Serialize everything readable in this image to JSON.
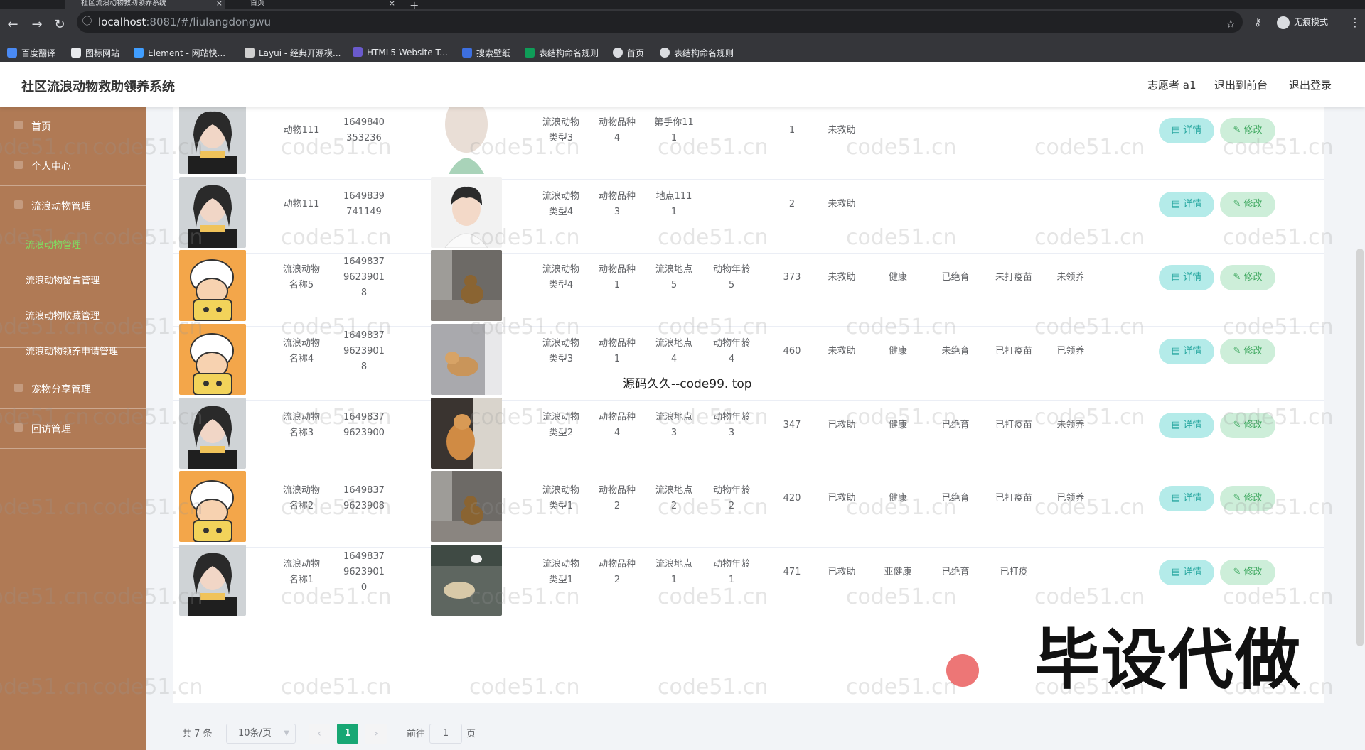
{
  "browser": {
    "tabs": [
      {
        "title": "社区流浪动物救助领养系统"
      },
      {
        "title": "首页"
      }
    ],
    "url_host": "localhost",
    "url_path": ":8081/#/liulangdongwu",
    "incognito_label": "无痕模式",
    "bookmarks": [
      "百度翻译",
      "图标网站",
      "Element - 网站快...",
      "Layui - 经典开源模...",
      "HTML5 Website T...",
      "搜索壁纸",
      "表结构命名规则",
      "首页",
      "表结构命名规则"
    ]
  },
  "header": {
    "title": "社区流浪动物救助领养系统",
    "user": "志愿者 a1",
    "to_front": "退出到前台",
    "logout": "退出登录"
  },
  "sidebar": {
    "items": [
      {
        "label": "首页"
      },
      {
        "label": "个人中心"
      },
      {
        "label": "流浪动物管理"
      },
      {
        "label": "宠物分享管理"
      },
      {
        "label": "回访管理"
      }
    ],
    "subitems": [
      "流浪动物管理",
      "流浪动物留言管理",
      "流浪动物收藏管理",
      "流浪动物领养申请管理"
    ]
  },
  "table": {
    "detail_label": "详情",
    "edit_label": "修改",
    "rows": [
      {
        "avatar": "girl",
        "name": "动物111",
        "id": "1649840\n353236",
        "photo": "partial",
        "type": "流浪动物\n类型3",
        "breed": "动物品种\n4",
        "location": "第手你11\n1",
        "age": "",
        "count": "1",
        "rescue": "未救助",
        "health": "",
        "neuter": "",
        "vaccine": "",
        "adopt": ""
      },
      {
        "avatar": "girl",
        "name": "动物111",
        "id": "1649839\n741149",
        "photo": "boy",
        "type": "流浪动物\n类型4",
        "breed": "动物品种\n3",
        "location": "地点111\n1",
        "age": "",
        "count": "2",
        "rescue": "未救助",
        "health": "",
        "neuter": "",
        "vaccine": "",
        "adopt": ""
      },
      {
        "avatar": "cartoon",
        "name": "流浪动物\n名称5",
        "id": "1649837\n9623901\n8",
        "photo": "dog",
        "type": "流浪动物\n类型4",
        "breed": "动物品种\n1",
        "location": "流浪地点\n5",
        "age": "动物年龄\n5",
        "count": "373",
        "rescue": "未救助",
        "health": "健康",
        "neuter": "已绝育",
        "vaccine": "未打疫苗",
        "adopt": "未领养"
      },
      {
        "avatar": "cartoon",
        "name": "流浪动物\n名称4",
        "id": "1649837\n9623901\n8",
        "photo": "dog2",
        "type": "流浪动物\n类型3",
        "breed": "动物品种\n1",
        "location": "流浪地点\n4",
        "age": "动物年龄\n4",
        "count": "460",
        "rescue": "未救助",
        "health": "健康",
        "neuter": "未绝育",
        "vaccine": "已打疫苗",
        "adopt": "已领养"
      },
      {
        "avatar": "girl",
        "name": "流浪动物\n名称3",
        "id": "1649837\n9623900",
        "photo": "cat",
        "type": "流浪动物\n类型2",
        "breed": "动物品种\n4",
        "location": "流浪地点\n3",
        "age": "动物年龄\n3",
        "count": "347",
        "rescue": "已救助",
        "health": "健康",
        "neuter": "已绝育",
        "vaccine": "已打疫苗",
        "adopt": "未领养"
      },
      {
        "avatar": "cartoon",
        "name": "流浪动物\n名称2",
        "id": "1649837\n9623908",
        "photo": "dog",
        "type": "流浪动物\n类型1",
        "breed": "动物品种\n2",
        "location": "流浪地点\n2",
        "age": "动物年龄\n2",
        "count": "420",
        "rescue": "已救助",
        "health": "健康",
        "neuter": "已绝育",
        "vaccine": "已打疫苗",
        "adopt": "已领养"
      },
      {
        "avatar": "girl",
        "name": "流浪动物\n名称1",
        "id": "1649837\n9623901\n0",
        "photo": "cats",
        "type": "流浪动物\n类型1",
        "breed": "动物品种\n2",
        "location": "流浪地点\n1",
        "age": "动物年龄\n1",
        "count": "471",
        "rescue": "已救助",
        "health": "亚健康",
        "neuter": "已绝育",
        "vaccine": "已打疫",
        "adopt": ""
      }
    ]
  },
  "pagination": {
    "total": "共 7 条",
    "page_size": "10条/页",
    "current": "1",
    "goto_prefix": "前往",
    "goto_value": "1",
    "goto_suffix": "页"
  },
  "overlays": {
    "watermark": "code51.cn",
    "promo": "毕设代做",
    "source_text": "源码久久--code99. top"
  }
}
